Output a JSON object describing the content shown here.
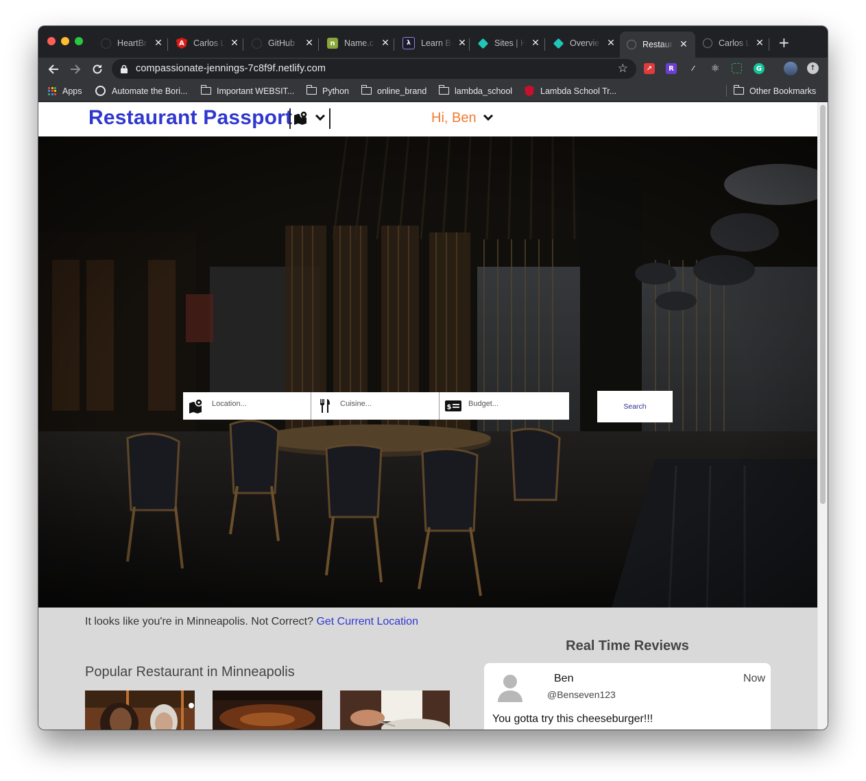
{
  "browser": {
    "tabs": [
      {
        "title": "HeartBr",
        "favicon": "github-icon"
      },
      {
        "title": "Carlos L",
        "favicon": "angular-shield-icon"
      },
      {
        "title": "GitHub",
        "favicon": "github-icon"
      },
      {
        "title": "Name.c",
        "favicon": "name-icon"
      },
      {
        "title": "Learn B",
        "favicon": "lambda-icon"
      },
      {
        "title": "Sites | H",
        "favicon": "netlify-diamond-icon"
      },
      {
        "title": "Overvie",
        "favicon": "netlify-diamond-icon"
      },
      {
        "title": "Restaur",
        "favicon": "globe-icon",
        "active": true
      },
      {
        "title": "Carlos L",
        "favicon": "globe-icon"
      }
    ],
    "new_tab": "+",
    "close_glyph": "✕",
    "url": "compassionate-jennings-7c8f9f.netlify.com",
    "bookmarks": [
      {
        "label": "Apps",
        "icon": "apps-grid-icon"
      },
      {
        "label": "Automate the Bori...",
        "icon": "globe-icon"
      },
      {
        "label": "Important WEBSIT...",
        "icon": "folder-icon"
      },
      {
        "label": "Python",
        "icon": "folder-icon"
      },
      {
        "label": "online_brand",
        "icon": "folder-icon"
      },
      {
        "label": "lambda_school",
        "icon": "folder-icon"
      },
      {
        "label": "Lambda School Tr...",
        "icon": "lambda-shield-icon"
      }
    ],
    "other_bookmarks": "Other Bookmarks",
    "extensions_letter": "R"
  },
  "app": {
    "brand": "Restaurant Passport",
    "greeting": "Hi, Ben",
    "search": {
      "location_placeholder": "Location...",
      "cuisine_placeholder": "Cuisine...",
      "budget_placeholder": "Budget...",
      "button": "Search"
    },
    "location_notice": "It looks like you're in Minneapolis. Not Correct?",
    "location_link": "Get Current Location",
    "popular_heading": "Popular Restaurant in Minneapolis",
    "reviews_heading": "Real Time Reviews",
    "review": {
      "name": "Ben",
      "handle": "@Benseven123",
      "time": "Now",
      "text": "You gotta try this cheeseburger!!!"
    }
  },
  "colors": {
    "brand": "#2f37d0",
    "greeting": "#f07a2e",
    "link": "#2f37d0"
  }
}
